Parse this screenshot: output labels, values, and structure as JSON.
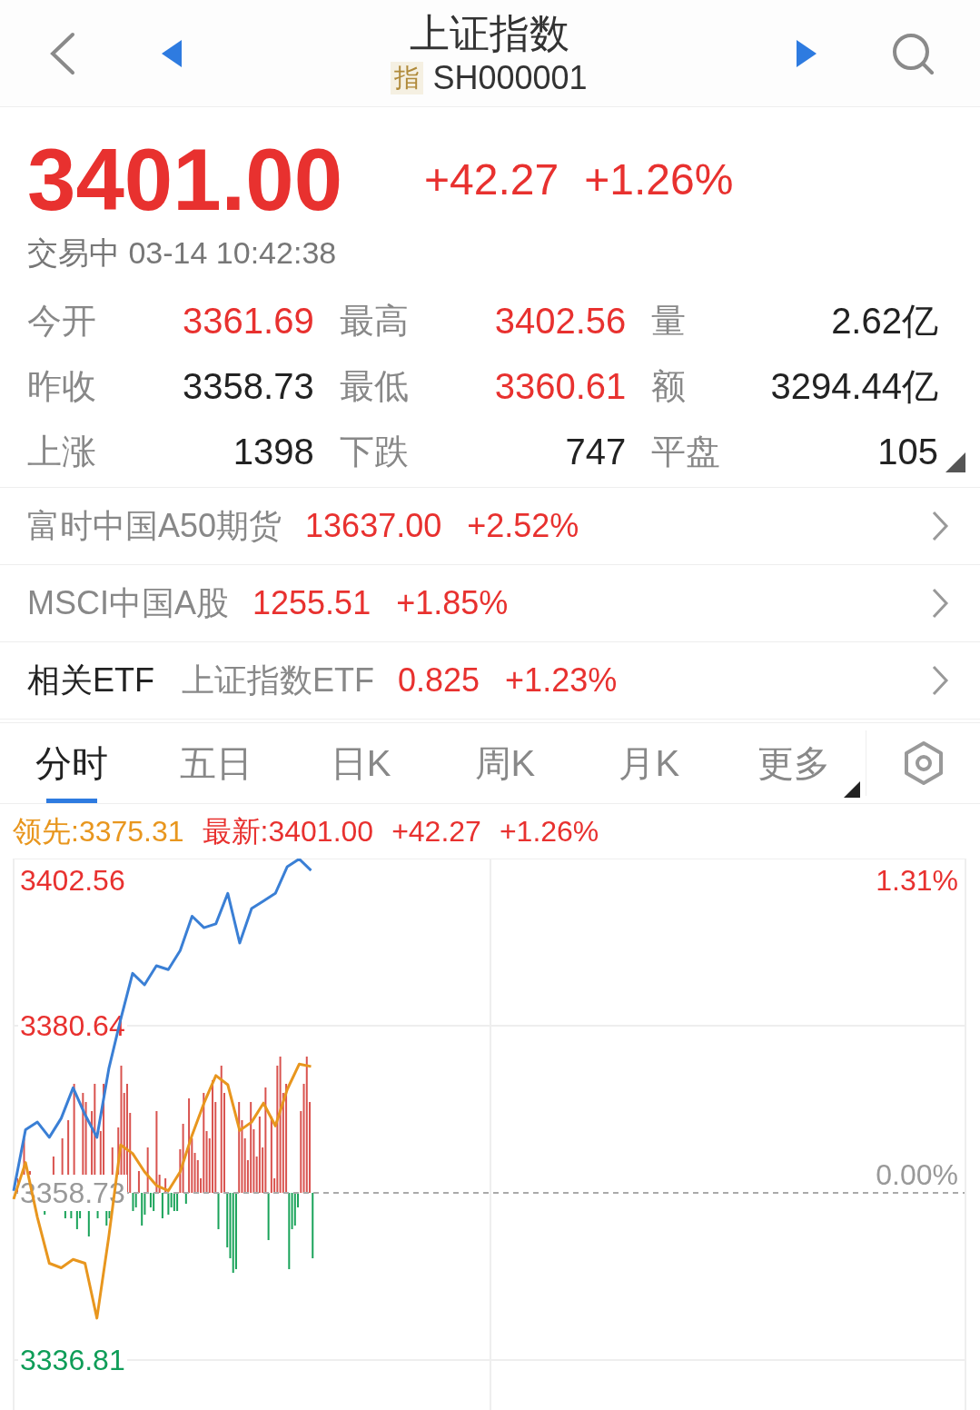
{
  "header": {
    "title": "上证指数",
    "badge": "指",
    "code": "SH000001"
  },
  "quote": {
    "price": "3401.00",
    "change": "+42.27",
    "percent": "+1.26%",
    "status": "交易中 03-14 10:42:38"
  },
  "stats": [
    {
      "label": "今开",
      "value": "3361.69",
      "kind": "up"
    },
    {
      "label": "最高",
      "value": "3402.56",
      "kind": "up"
    },
    {
      "label": "量",
      "value": "2.62亿",
      "kind": "flat"
    },
    {
      "label": "昨收",
      "value": "3358.73",
      "kind": "flat"
    },
    {
      "label": "最低",
      "value": "3360.61",
      "kind": "up"
    },
    {
      "label": "额",
      "value": "3294.44亿",
      "kind": "flat"
    },
    {
      "label": "上涨",
      "value": "1398",
      "kind": "flat"
    },
    {
      "label": "下跌",
      "value": "747",
      "kind": "flat"
    },
    {
      "label": "平盘",
      "value": "105",
      "kind": "flat"
    }
  ],
  "related": [
    {
      "label": "富时中国A50期货",
      "value": "13637.00",
      "change": "+2.52%",
      "kind": "muted"
    },
    {
      "label": "MSCI中国A股",
      "value": "1255.51",
      "change": "+1.85%",
      "kind": "muted"
    },
    {
      "label": "相关ETF",
      "sublabel": "上证指数ETF",
      "value": "0.825",
      "change": "+1.23%",
      "kind": "strong"
    }
  ],
  "tabs": [
    {
      "label": "分时",
      "selected": true
    },
    {
      "label": "五日",
      "selected": false
    },
    {
      "label": "日K",
      "selected": false
    },
    {
      "label": "周K",
      "selected": false
    },
    {
      "label": "月K",
      "selected": false
    },
    {
      "label": "更多",
      "selected": false
    }
  ],
  "legend": {
    "leading": "领先:3375.31",
    "latest": "最新:3401.00",
    "change": "+42.27",
    "percent": "+1.26%"
  },
  "chart_data": {
    "type": "line",
    "ylim": [
      3336.81,
      3402.56
    ],
    "yticks": [
      {
        "value": 3402.56,
        "label": "3402.56"
      },
      {
        "value": 3380.64,
        "label": "3380.64"
      },
      {
        "value": 3358.73,
        "label": "3358.73"
      },
      {
        "value": 3336.81,
        "label": "3336.81"
      }
    ],
    "categories": [
      null,
      null,
      null,
      null,
      null,
      null,
      null,
      null,
      null,
      null,
      null,
      null,
      null,
      null,
      null,
      null,
      null,
      null,
      null,
      null,
      null,
      null,
      null,
      null,
      null,
      null,
      null,
      null,
      null,
      null,
      null,
      null,
      null,
      null,
      null,
      null,
      null,
      null,
      null,
      null,
      null,
      null,
      null,
      null,
      null,
      null,
      null,
      null,
      null,
      null,
      null,
      null,
      null,
      null,
      null,
      null,
      null,
      null,
      null,
      null,
      null,
      null,
      null,
      null,
      null,
      null,
      null,
      null,
      null,
      null,
      null,
      null,
      null,
      null,
      null,
      null,
      null,
      null,
      null,
      null,
      null
    ],
    "series": [
      {
        "color": "#3a7fd5",
        "values": [
          3359.0,
          3367.0,
          3368.0,
          3366.0,
          3368.5,
          3372.5,
          3369.0,
          3366.0,
          3375.0,
          3381.5,
          3387.5,
          3386.0,
          3388.5,
          3388.0,
          3390.5,
          3395.0,
          3393.5,
          3394.0,
          3398.0,
          3391.5,
          3396.0,
          3397.0,
          3398.0,
          3401.5,
          3402.5,
          3401.0,
          null,
          null,
          null,
          null,
          null,
          null,
          null,
          null,
          null,
          null,
          null,
          null,
          null,
          null,
          null,
          null,
          null,
          null,
          null,
          null,
          null,
          null,
          null,
          null,
          null,
          null,
          null,
          null,
          null,
          null,
          null,
          null,
          null,
          null,
          null,
          null,
          null,
          null,
          null,
          null,
          null,
          null,
          null,
          null,
          null,
          null,
          null,
          null,
          null,
          null,
          null,
          null,
          null,
          null,
          null
        ]
      },
      {
        "color": "#e8961e",
        "values": [
          3357.9,
          3362.7,
          3355.5,
          3349.5,
          3348.9,
          3350.0,
          3349.5,
          3342.3,
          3353.0,
          3365.0,
          3363.9,
          3361.5,
          3359.7,
          3359.0,
          3361.5,
          3366.3,
          3370.5,
          3374.1,
          3372.9,
          3366.9,
          3368.0,
          3370.5,
          3367.5,
          3372.3,
          3375.6,
          3375.3,
          null,
          null,
          null,
          null,
          null,
          null,
          null,
          null,
          null,
          null,
          null,
          null,
          null,
          null,
          null,
          null,
          null,
          null,
          null,
          null,
          null,
          null,
          null,
          null,
          null,
          null,
          null,
          null,
          null,
          null,
          null,
          null,
          null,
          null,
          null,
          null,
          null,
          null,
          null,
          null,
          null,
          null,
          null,
          null,
          null,
          null,
          null,
          null,
          null,
          null,
          null,
          null,
          null,
          null,
          null
        ]
      }
    ],
    "annotations": [
      "1.31%",
      "0.00%"
    ]
  }
}
